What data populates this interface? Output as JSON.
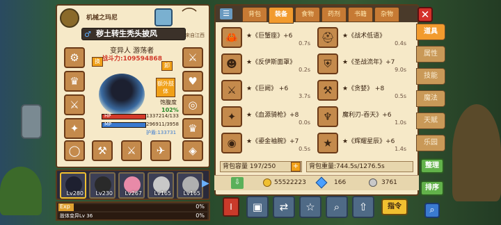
{
  "character": {
    "title": "机械之玛尼",
    "name": "秽土转生秃头披风",
    "origin": "来自江西",
    "subtitle": "变异人 游荡者",
    "combat_power": "战斗力:109594868",
    "hp": "1337214/133",
    "mp": "296911/3958",
    "shield": "护盾:133731",
    "fullness_label": "饱腹度",
    "fullness_value": "102%",
    "swap_label": "换",
    "unload_label": "卸",
    "extra_label": "额外肢体",
    "hp_label": "HP",
    "mp_label": "MP"
  },
  "portraits": [
    {
      "level": "Lv280"
    },
    {
      "level": "Lv230"
    },
    {
      "level": "Lv267"
    },
    {
      "level": "Lv165"
    },
    {
      "level": "Lv165"
    }
  ],
  "exp": {
    "label": "Exp",
    "percent": "0%",
    "sub_label": "肢体变异Lv 36",
    "sub_percent": "0%"
  },
  "tabs": [
    "背包",
    "装备",
    "食物",
    "药剂",
    "书籍",
    "杂物"
  ],
  "active_tab": "装备",
  "items": [
    {
      "name": "★《巨蟹座》+6",
      "cd": "0.7s",
      "icon": "crab-icon"
    },
    {
      "name": "★《战术低语》",
      "cd": "0.4s",
      "icon": "helmet-icon"
    },
    {
      "name": "★《反伊斯面罩》",
      "cd": "0.2s",
      "icon": "mask-icon"
    },
    {
      "name": "★《圣战流年》+7",
      "cd": "9.0s",
      "icon": "shield-icon"
    },
    {
      "name": "★《巨阙》 +6",
      "cd": "3.7s",
      "icon": "sword-icon"
    },
    {
      "name": "★《贪婪》 +8",
      "cd": "0.5s",
      "icon": "axe-icon"
    },
    {
      "name": "★《血源骑枪》+8",
      "cd": "0.0s",
      "icon": "lance-icon"
    },
    {
      "name": "魔利刃-吞天》+6",
      "cd": "1.0s",
      "icon": "blade-icon"
    },
    {
      "name": "★《鎏金袖腕》+7",
      "cd": "0.5s",
      "icon": "bracer-icon"
    },
    {
      "name": "★《辉耀星辰》+6",
      "cd": "1.4s",
      "icon": "star-icon"
    }
  ],
  "capacity": "背包容量 197/250",
  "weight": "背包重量:744.5s/1276.5s",
  "currency": {
    "gold": "55522223",
    "gems": "166",
    "silver": "3761"
  },
  "side_tabs": [
    "道具",
    "属性",
    "技能",
    "魔法",
    "天赋",
    "乐园"
  ],
  "active_side_tab": "道具",
  "buttons": {
    "sort": "整理",
    "order": "排序",
    "command": "指令"
  },
  "colors": {
    "panel": "#f6e9c8",
    "accent": "#f29b2e",
    "green": "#62b24a"
  }
}
